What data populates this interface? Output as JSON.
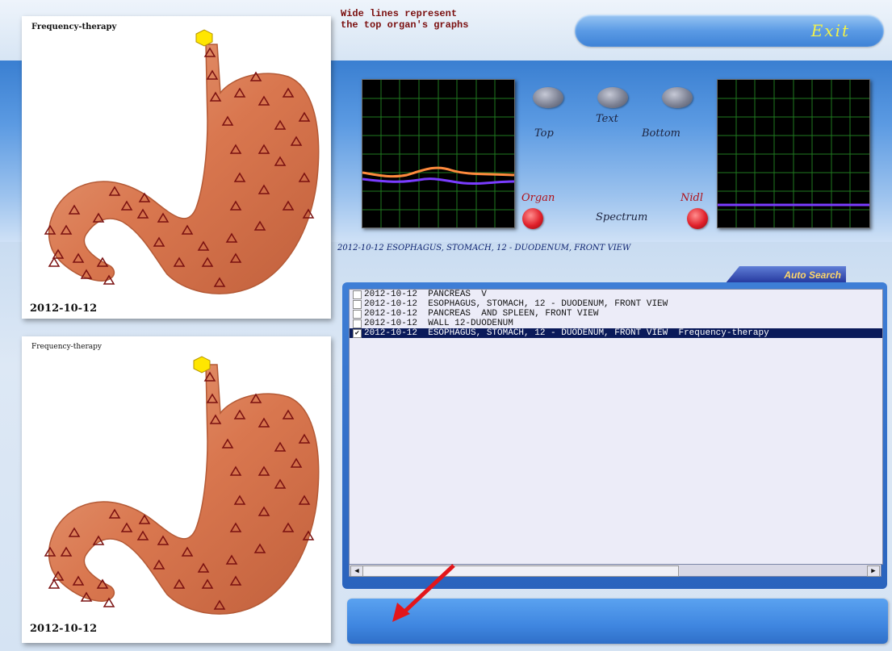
{
  "header": {
    "note_line1": "Wide lines represent",
    "note_line2": "the top organ's graphs",
    "exit_label": "Exit"
  },
  "panels": [
    {
      "title": "Frequency-therapy",
      "date": "2012-10-12"
    },
    {
      "title": "Frequency-therapy",
      "date": "2012-10-12"
    }
  ],
  "controls": {
    "top_label": "Top",
    "text_label": "Text",
    "bottom_label": "Bottom",
    "organ_label": "Organ",
    "spectrum_label": "Spectrum",
    "nidl_label": "Nidl"
  },
  "caption": "2012-10-12 ESOPHAGUS, STOMACH, 12 - DUODENUM, FRONT VIEW",
  "auto_search_label": "Auto Search",
  "list": {
    "rows": [
      {
        "checked": false,
        "text": "2012-10-12  PANCREAS  V"
      },
      {
        "checked": false,
        "text": "2012-10-12  ESOPHAGUS, STOMACH, 12 - DUODENUM, FRONT VIEW"
      },
      {
        "checked": false,
        "text": "2012-10-12  PANCREAS  AND SPLEEN, FRONT VIEW"
      },
      {
        "checked": false,
        "text": "2012-10-12  WALL 12-DUODENUM"
      },
      {
        "checked": true,
        "text": "2012-10-12  ESOPHAGUS, STOMACH, 12 - DUODENUM, FRONT VIEW  Frequency-therapy",
        "selected": true
      }
    ]
  },
  "colors": {
    "graph_orange": "#ff8a3d",
    "graph_purple": "#7a3cff",
    "graph_grid": "#1f7a1f",
    "arrow_red": "#e3161b"
  }
}
